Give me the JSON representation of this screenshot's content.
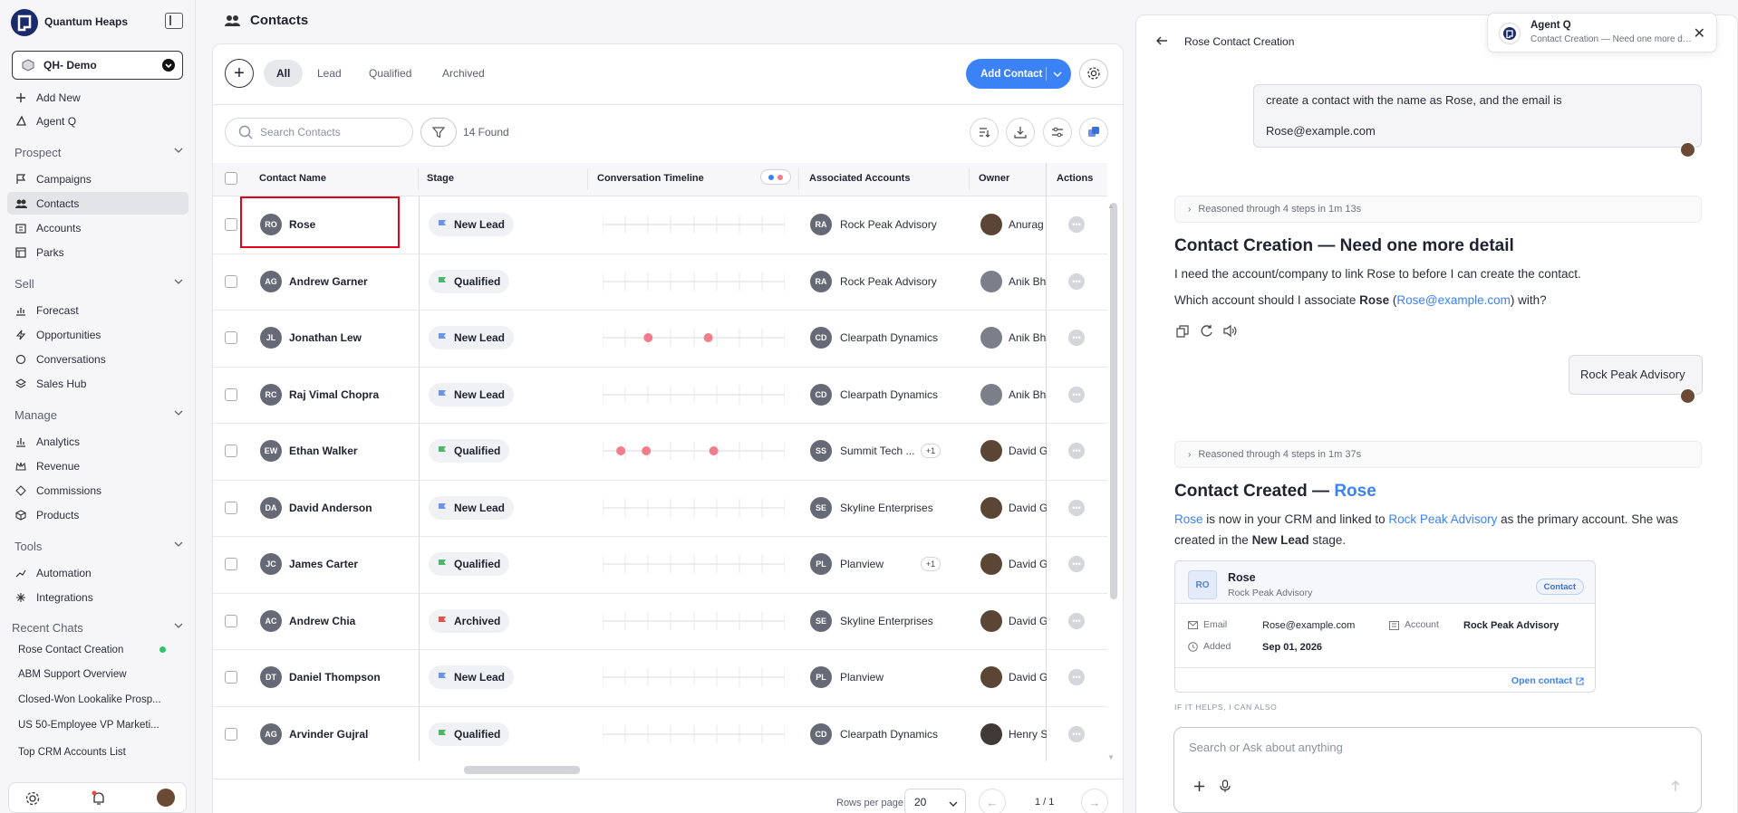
{
  "app": {
    "brand": "Quantum Heaps",
    "workspace": "QH- Demo"
  },
  "sidebar": {
    "top_items": [
      {
        "label": "Add New",
        "icon": "plus-icon"
      },
      {
        "label": "Agent Q",
        "icon": "agent-icon"
      }
    ],
    "sections": [
      {
        "title": "Prospect",
        "items": [
          "Campaigns",
          "Contacts",
          "Accounts",
          "Parks"
        ]
      },
      {
        "title": "Sell",
        "items": [
          "Forecast",
          "Opportunities",
          "Conversations",
          "Sales Hub"
        ]
      },
      {
        "title": "Manage",
        "items": [
          "Analytics",
          "Revenue",
          "Commissions",
          "Products"
        ]
      },
      {
        "title": "Tools",
        "items": [
          "Automation",
          "Integrations"
        ]
      }
    ],
    "active_item": "Contacts",
    "recent_chats_title": "Recent Chats",
    "recent_chats": [
      "Rose Contact Creation",
      "ABM Support Overview",
      "Closed-Won Lookalike Prosp...",
      "US 50-Employee VP Marketi...",
      "Top CRM Accounts List"
    ]
  },
  "main": {
    "title": "Contacts",
    "tabs": [
      "All",
      "Lead",
      "Qualified",
      "Archived"
    ],
    "active_tab": "All",
    "add_contact_label": "Add Contact",
    "search_placeholder": "Search Contacts",
    "found_text": "14 Found",
    "columns": [
      "Contact Name",
      "Stage",
      "Conversation Timeline",
      "Associated Accounts",
      "Owner",
      "Actions"
    ],
    "rows": [
      {
        "initials": "RO",
        "name": "Rose",
        "stage": "New Lead",
        "dots": [],
        "acct_initials": "RA",
        "account": "Rock Peak Advisory",
        "extra": "",
        "owner": "Anurag"
      },
      {
        "initials": "AG",
        "name": "Andrew Garner",
        "stage": "Qualified",
        "dots": [],
        "acct_initials": "RA",
        "account": "Rock Peak Advisory",
        "extra": "",
        "owner": "Anik Bh"
      },
      {
        "initials": "JL",
        "name": "Jonathan Lew",
        "stage": "New Lead",
        "dots": [
          0.25,
          0.58
        ],
        "acct_initials": "CD",
        "account": "Clearpath Dynamics",
        "extra": "",
        "owner": "Anik Bh"
      },
      {
        "initials": "RC",
        "name": "Raj Vimal Chopra",
        "stage": "New Lead",
        "dots": [],
        "acct_initials": "CD",
        "account": "Clearpath Dynamics",
        "extra": "",
        "owner": "Anik Bh"
      },
      {
        "initials": "EW",
        "name": "Ethan Walker",
        "stage": "Qualified",
        "dots": [
          0.1,
          0.24,
          0.61
        ],
        "acct_initials": "SS",
        "account": "Summit Tech ...",
        "extra": "+1",
        "owner": "David G"
      },
      {
        "initials": "DA",
        "name": "David Anderson",
        "stage": "New Lead",
        "dots": [],
        "acct_initials": "SE",
        "account": "Skyline Enterprises",
        "extra": "",
        "owner": "David G"
      },
      {
        "initials": "JC",
        "name": "James Carter",
        "stage": "Qualified",
        "dots": [],
        "acct_initials": "PL",
        "account": "Planview",
        "extra": "+1",
        "owner": "David G"
      },
      {
        "initials": "AC",
        "name": "Andrew Chia",
        "stage": "Archived",
        "dots": [],
        "acct_initials": "SE",
        "account": "Skyline Enterprises",
        "extra": "",
        "owner": "David G"
      },
      {
        "initials": "DT",
        "name": "Daniel Thompson",
        "stage": "New Lead",
        "dots": [],
        "acct_initials": "PL",
        "account": "Planview",
        "extra": "",
        "owner": "David G"
      },
      {
        "initials": "AG",
        "name": "Arvinder Gujral",
        "stage": "Qualified",
        "dots": [],
        "acct_initials": "CD",
        "account": "Clearpath Dynamics",
        "extra": "",
        "owner": "Henry S"
      }
    ],
    "stage_colors": {
      "New Lead": "#6f93e8",
      "Qualified": "#4fb36a",
      "Archived": "#e0524e"
    },
    "dot_color": "#f47c8a",
    "rows_per_page_label": "Rows per page",
    "rows_per_page": "20",
    "page_text": "1 / 1"
  },
  "agent": {
    "panel_title": "Rose Contact Creation",
    "user_msg_1": [
      "create a contact with the name as Rose, and the email is",
      "Rose@example.com"
    ],
    "reason_1": "Reasoned through 4 steps in 1m 13s",
    "h1": "Contact Creation — Need one more detail",
    "p1": "I need the account/company to link Rose to before I can create the contact.",
    "p2_a": "Which account should I associate ",
    "p2_name": "Rose",
    "p2_b": " (",
    "p2_email": "Rose@example.com",
    "p2_c": ") with?",
    "user_msg_2": "Rock Peak Advisory",
    "reason_2": "Reasoned through 4 steps in 1m 37s",
    "h2_a": "Contact Created — ",
    "h2_b": "Rose",
    "p3_name": "Rose",
    "p3_a": " is now in your CRM and linked to ",
    "p3_acct": "Rock Peak Advisory",
    "p3_b": " as the primary account. She was",
    "p4_a": "created in the ",
    "p4_stage": "New Lead",
    "p4_b": " stage.",
    "card": {
      "initials": "RO",
      "name": "Rose",
      "sub": "Rock Peak Advisory",
      "badge": "Contact",
      "email_label": "Email",
      "email": "Rose@example.com",
      "account_label": "Account",
      "account": "Rock Peak Advisory",
      "added_label": "Added",
      "added": "Sep 01, 2026",
      "open_link": "Open contact"
    },
    "also_label": "IF IT HELPS, I CAN ALSO",
    "composer_placeholder": "Search or Ask about anything"
  },
  "toast": {
    "title": "Agent Q",
    "sub": "Contact Creation — Need one more det..."
  }
}
